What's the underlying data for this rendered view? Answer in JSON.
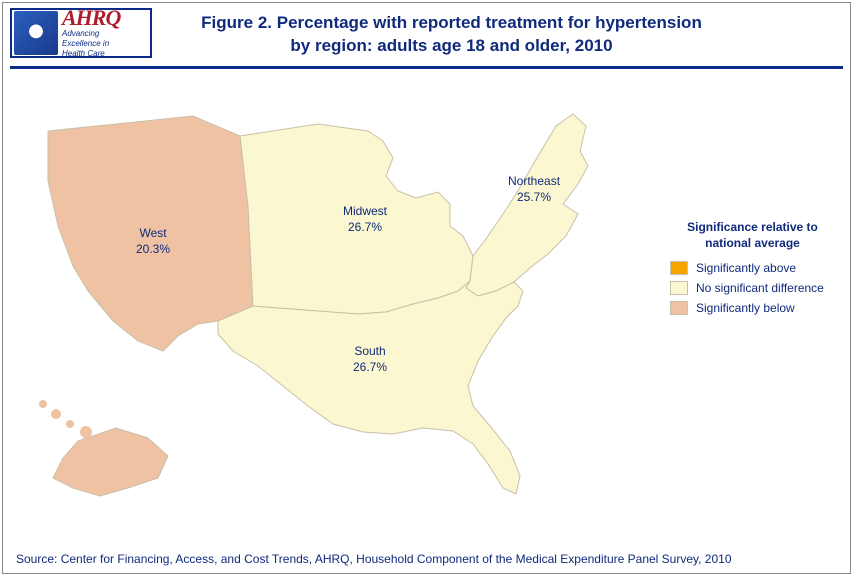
{
  "logo": {
    "brand": "AHRQ",
    "tagline1": "Advancing",
    "tagline2": "Excellence in",
    "tagline3": "Health Care"
  },
  "title_line1": "Figure 2. Percentage with reported treatment for hypertension",
  "title_line2": "by region: adults age 18 and older, 2010",
  "chart_data": {
    "type": "map",
    "title": "Percentage with reported treatment for hypertension by region: adults age 18 and older, 2010",
    "regions": [
      {
        "name": "West",
        "value": 20.3,
        "significance": "below"
      },
      {
        "name": "Midwest",
        "value": 26.7,
        "significance": "none"
      },
      {
        "name": "South",
        "value": 26.7,
        "significance": "none"
      },
      {
        "name": "Northeast",
        "value": 25.7,
        "significance": "none"
      }
    ],
    "legend": {
      "title": "Significance relative to national average",
      "items": [
        {
          "key": "above",
          "label": "Significantly above",
          "color": "#f7a400"
        },
        {
          "key": "none",
          "label": "No significant difference",
          "color": "#fbf7d0"
        },
        {
          "key": "below",
          "label": "Significantly below",
          "color": "#eec2a3"
        }
      ]
    }
  },
  "labels": {
    "west": {
      "name": "West",
      "pct": "20.3%"
    },
    "midwest": {
      "name": "Midwest",
      "pct": "26.7%"
    },
    "south": {
      "name": "South",
      "pct": "26.7%"
    },
    "northeast": {
      "name": "Northeast",
      "pct": "25.7%"
    }
  },
  "source": "Source: Center for Financing, Access, and Cost Trends, AHRQ, Household Component of the Medical Expenditure Panel Survey, 2010"
}
